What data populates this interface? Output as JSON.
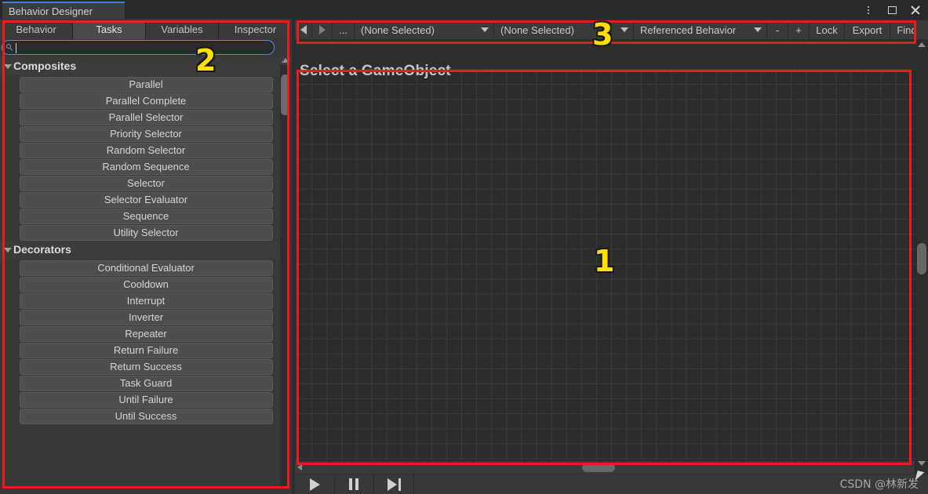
{
  "window": {
    "title": "Behavior Designer",
    "controls": [
      {
        "name": "more-options-icon",
        "label": "⋮"
      },
      {
        "name": "maximize-icon",
        "label": "▢"
      },
      {
        "name": "close-icon",
        "label": "✕"
      }
    ]
  },
  "left_panel": {
    "tabs": [
      {
        "label": "Behavior",
        "active": false
      },
      {
        "label": "Tasks",
        "active": true
      },
      {
        "label": "Variables",
        "active": false
      },
      {
        "label": "Inspector",
        "active": false
      }
    ],
    "search": {
      "value": "",
      "placeholder": "",
      "icon": "search-icon"
    },
    "groups": [
      {
        "label": "Composites",
        "expanded": true,
        "items": [
          "Parallel",
          "Parallel Complete",
          "Parallel Selector",
          "Priority Selector",
          "Random Selector",
          "Random Sequence",
          "Selector",
          "Selector Evaluator",
          "Sequence",
          "Utility Selector"
        ]
      },
      {
        "label": "Decorators",
        "expanded": true,
        "items": [
          "Conditional Evaluator",
          "Cooldown",
          "Interrupt",
          "Inverter",
          "Repeater",
          "Return Failure",
          "Return Success",
          "Task Guard",
          "Until Failure",
          "Until Success"
        ]
      }
    ]
  },
  "toolbar": {
    "back_icon": "back-arrow-icon",
    "forward_icon": "forward-arrow-icon",
    "ellipsis": "...",
    "behavior_select": "(None Selected)",
    "graph_select": "(None Selected)",
    "referenced_behavior": "Referenced Behavior",
    "zoom_out": "-",
    "zoom_in": "+",
    "lock": "Lock",
    "export": "Export",
    "find": "Find"
  },
  "graph": {
    "title": "Select a GameObject"
  },
  "playback": {
    "play": "play-icon",
    "pause": "pause-icon",
    "step": "step-forward-icon"
  },
  "annotations": [
    {
      "number": "1",
      "target": "graph-canvas"
    },
    {
      "number": "2",
      "target": "task-list-panel"
    },
    {
      "number": "3",
      "target": "graph-toolbar"
    }
  ],
  "watermark": "CSDN @林新发",
  "colors": {
    "accent": "#4b8fdc",
    "annotation_red": "#ef1b1b",
    "annotation_yellow": "#ffe000",
    "panel_bg": "#383838",
    "graph_bg": "#2b2b2b"
  }
}
